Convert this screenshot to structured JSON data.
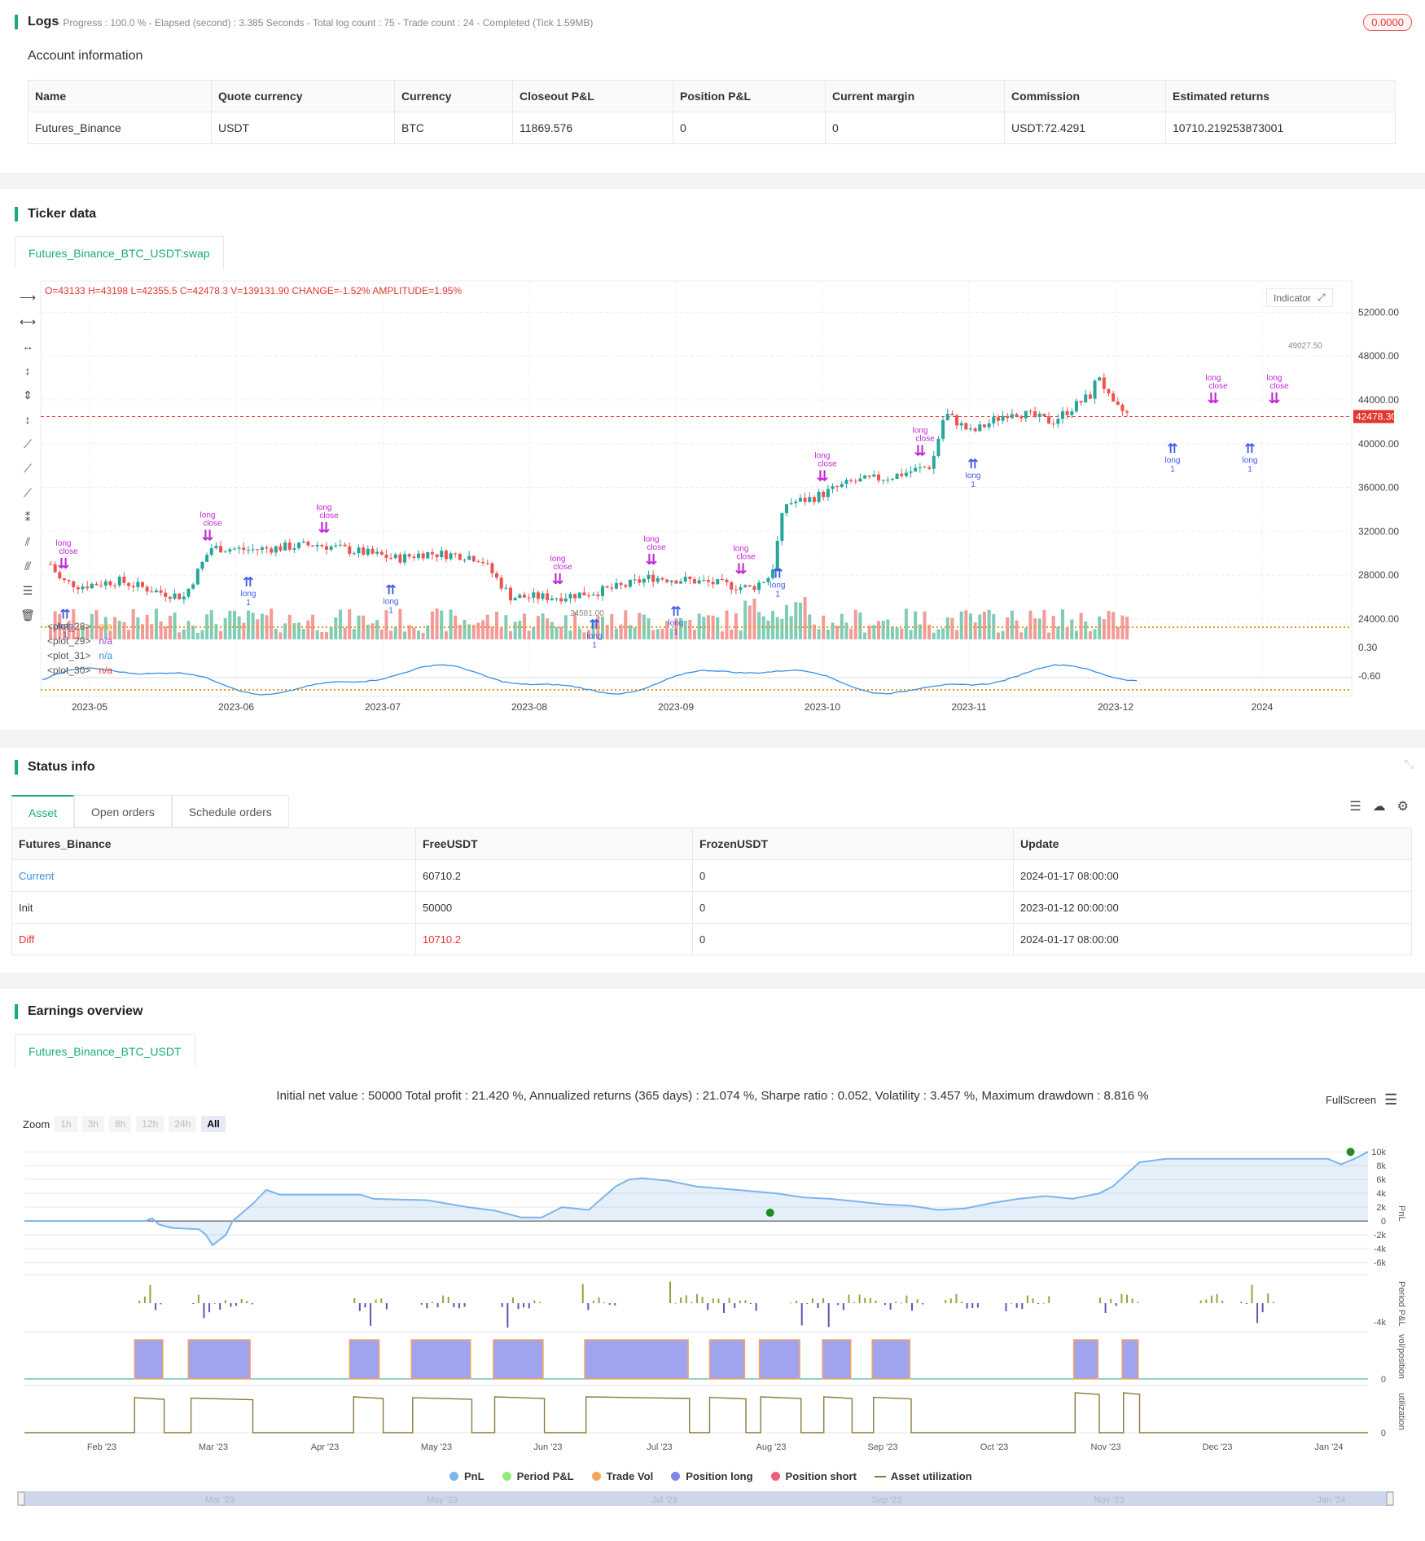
{
  "logs": {
    "title": "Logs",
    "meta": "- Progress : 100.0 % - Elapsed (second) : 3.385  Seconds - Total log count : 75 - Trade count : 24 - Completed (Tick 1.59MB)",
    "badge": "0.0000",
    "account_title": "Account information",
    "columns": [
      "Name",
      "Quote currency",
      "Currency",
      "Closeout P&L",
      "Position P&L",
      "Current margin",
      "Commission",
      "Estimated returns"
    ],
    "row": [
      "Futures_Binance",
      "USDT",
      "BTC",
      "11869.576",
      "0",
      "0",
      "USDT:72.4291",
      "10710.219253873001"
    ]
  },
  "ticker": {
    "title": "Ticker data",
    "tab": "Futures_Binance_BTC_USDT:swap",
    "ohlc": {
      "o": "O=43133",
      "h": "H=43198",
      "l": "L=42355.5",
      "c": "C=42478.3",
      "v": "V=139131.90",
      "change": "CHANGE=-1.52%",
      "amp": "AMPLITUDE=1.95%"
    },
    "indicator_btn": "Indicator",
    "price_label": "42478.30",
    "high_label": "49027.50",
    "low_label": "24581.00",
    "price_axis": [
      "52000.00",
      "48000.00",
      "44000.00",
      "40000.00",
      "36000.00",
      "32000.00",
      "28000.00",
      "24000.00"
    ],
    "osc_axis": [
      "0.30",
      "-0.60"
    ],
    "date_axis": [
      "2023-05",
      "2023-06",
      "2023-07",
      "2023-08",
      "2023-09",
      "2023-10",
      "2023-11",
      "2023-12",
      "2024"
    ],
    "plots": [
      {
        "name": "<plot_28>",
        "value": "n/a",
        "color": "#e69a2c"
      },
      {
        "name": "<plot_29>",
        "value": "n/a",
        "color": "#b23bcf"
      },
      {
        "name": "<plot_31>",
        "value": "n/a",
        "color": "#3b8ee0"
      },
      {
        "name": "<plot_30>",
        "value": "n/a",
        "color": "#e3342f"
      }
    ],
    "trade_labels": {
      "long": "long",
      "close": "close",
      "one": "1"
    }
  },
  "status": {
    "title": "Status info",
    "tabs": [
      "Asset",
      "Open orders",
      "Schedule orders"
    ],
    "columns": [
      "Futures_Binance",
      "FreeUSDT",
      "FrozenUSDT",
      "Update"
    ],
    "rows": [
      [
        "Current",
        "60710.2",
        "0",
        "2024-01-17 08:00:00"
      ],
      [
        "Init",
        "50000",
        "0",
        "2023-01-12 00:00:00"
      ],
      [
        "Diff",
        "10710.2",
        "0",
        "2024-01-17 08:00:00"
      ]
    ]
  },
  "earnings": {
    "title": "Earnings overview",
    "tab": "Futures_Binance_BTC_USDT",
    "summary": "Initial net value : 50000 Total profit : 21.420 %, Annualized returns (365 days) : 21.074 %, Sharpe ratio : 0.052, Volatility : 3.457 %, Maximum drawdown : 8.816 %",
    "fullscreen": "FullScreen",
    "zoom_label": "Zoom",
    "zoom_options": [
      "1h",
      "3h",
      "8h",
      "12h",
      "24h",
      "All"
    ],
    "pnl_axis": [
      "10k",
      "8k",
      "6k",
      "4k",
      "2k",
      "0",
      "-2k",
      "-4k",
      "-6k"
    ],
    "period_axis": [
      "-4k"
    ],
    "vol_axis": [
      "0"
    ],
    "util_axis": [
      "0"
    ],
    "panel_titles": [
      "PnL",
      "Period P&L",
      "vol/position",
      "utilization"
    ],
    "months": [
      "Feb '23",
      "Mar '23",
      "Apr '23",
      "May '23",
      "Jun '23",
      "Jul '23",
      "Aug '23",
      "Sep '23",
      "Oct '23",
      "Nov '23",
      "Dec '23",
      "Jan '24"
    ],
    "navigator_months": [
      "Mar '23",
      "May '23",
      "Jul '23",
      "Sep '23",
      "Nov '23",
      "Jan '24"
    ],
    "legend": [
      {
        "label": "PnL",
        "color": "#7cb5ec"
      },
      {
        "label": "Period P&L",
        "color": "#90ed7d"
      },
      {
        "label": "Trade Vol",
        "color": "#f7a35c"
      },
      {
        "label": "Position long",
        "color": "#8085e9"
      },
      {
        "label": "Position short",
        "color": "#f15c80"
      },
      {
        "label": "Asset utilization",
        "color": "#8b7a3a"
      }
    ]
  }
}
